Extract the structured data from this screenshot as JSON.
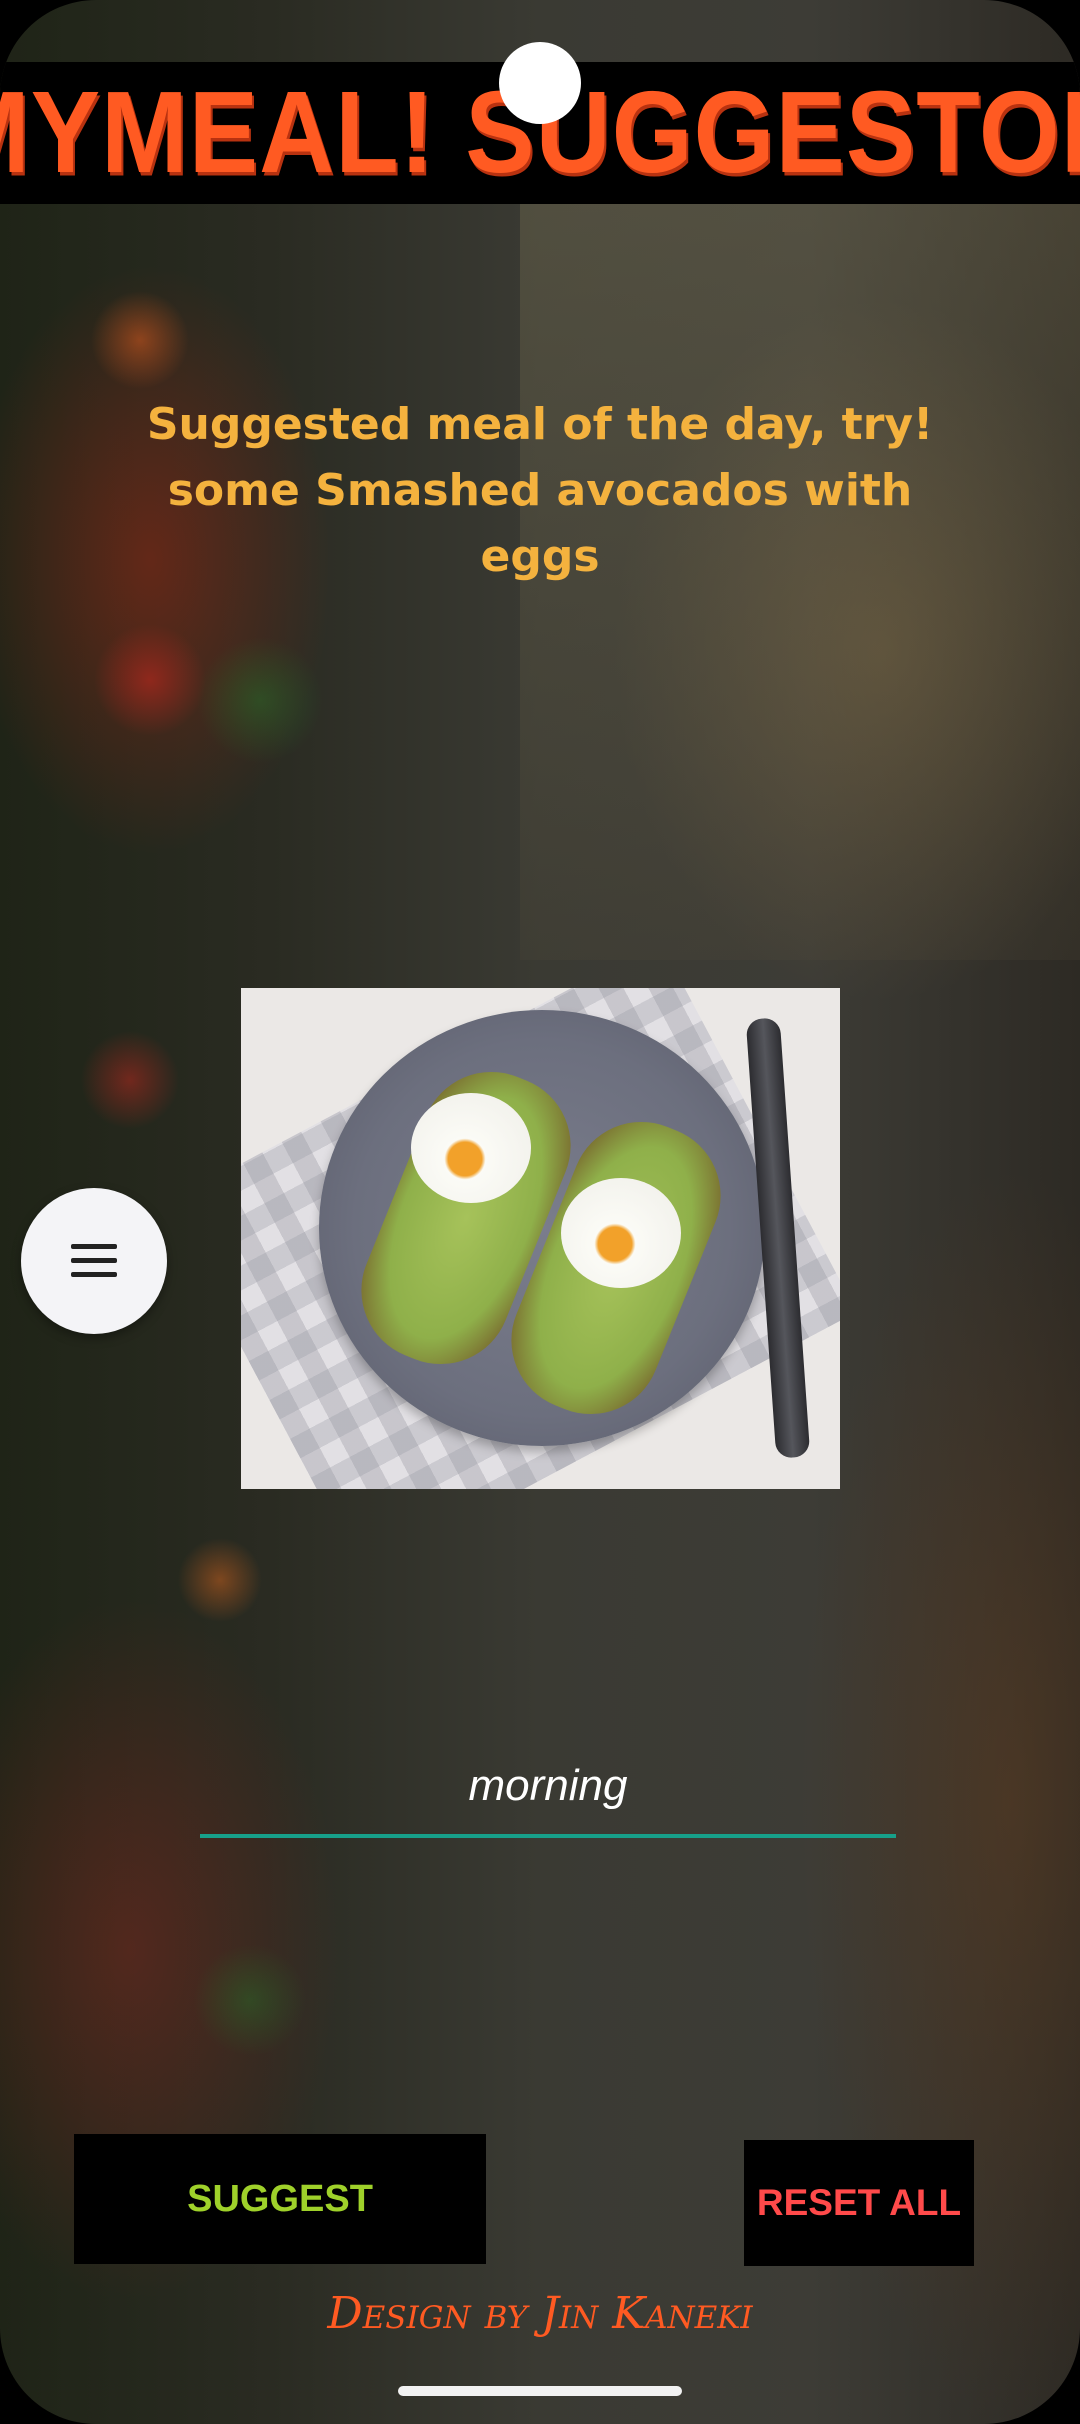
{
  "app": {
    "title": "MYMEAL! SUGGESTOR"
  },
  "meal_of_day": {
    "text": "Suggested meal of the day, try! some Smashed avocados with eggs",
    "image_alt": "Smashed avocados with eggs"
  },
  "menu": {
    "icon": "hamburger-menu-icon"
  },
  "input": {
    "value": "morning"
  },
  "buttons": {
    "suggest_label": "SUGGEST",
    "reset_label": "RESET ALL"
  },
  "footer": {
    "credit": "Design by Jin Kaneki"
  },
  "colors": {
    "title": "#ff5a22",
    "meal_text": "#f4b23e",
    "suggest_text": "#9fd12a",
    "reset_text": "#ff4a4a",
    "input_underline": "#17a08a"
  }
}
